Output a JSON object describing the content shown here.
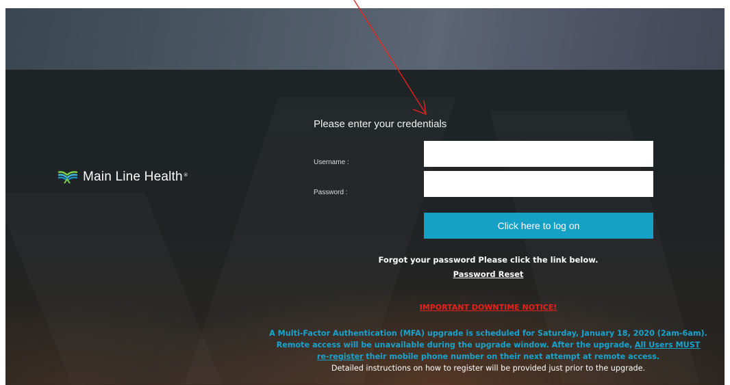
{
  "logo": {
    "text": "Main Line Health",
    "registered_mark": "®",
    "icon": "main-line-health-logo-icon"
  },
  "form": {
    "title": "Please enter your credentials",
    "username_label": "Username :",
    "username_value": "",
    "password_label": "Password :",
    "password_value": "",
    "logon_button_label": "Click here to log on"
  },
  "forgot": {
    "text": "Forgot your password Please click the link below.",
    "reset_link": "Password Reset"
  },
  "notice": {
    "title": "IMPORTANT DOWNTIME NOTICE!",
    "line1": "A Multi-Factor Authentication (MFA) upgrade is scheduled for Saturday, January 18, 2020 (2am-6am).",
    "line2_prefix": "Remote access will be unavailable during the upgrade window. After the upgrade,",
    "line2_link": "All Users MUST",
    "line3_link": "re-register",
    "line3_suffix": "their mobile phone number on their next attempt at remote access.",
    "line4": "Detailed instructions on how to register will be provided just prior to the upgrade."
  },
  "colors": {
    "accent": "#15a0c6",
    "notice_red": "#e8221b",
    "annotation_arrow": "#e8221b"
  },
  "annotation": {
    "icon": "red-arrow-annotation"
  }
}
